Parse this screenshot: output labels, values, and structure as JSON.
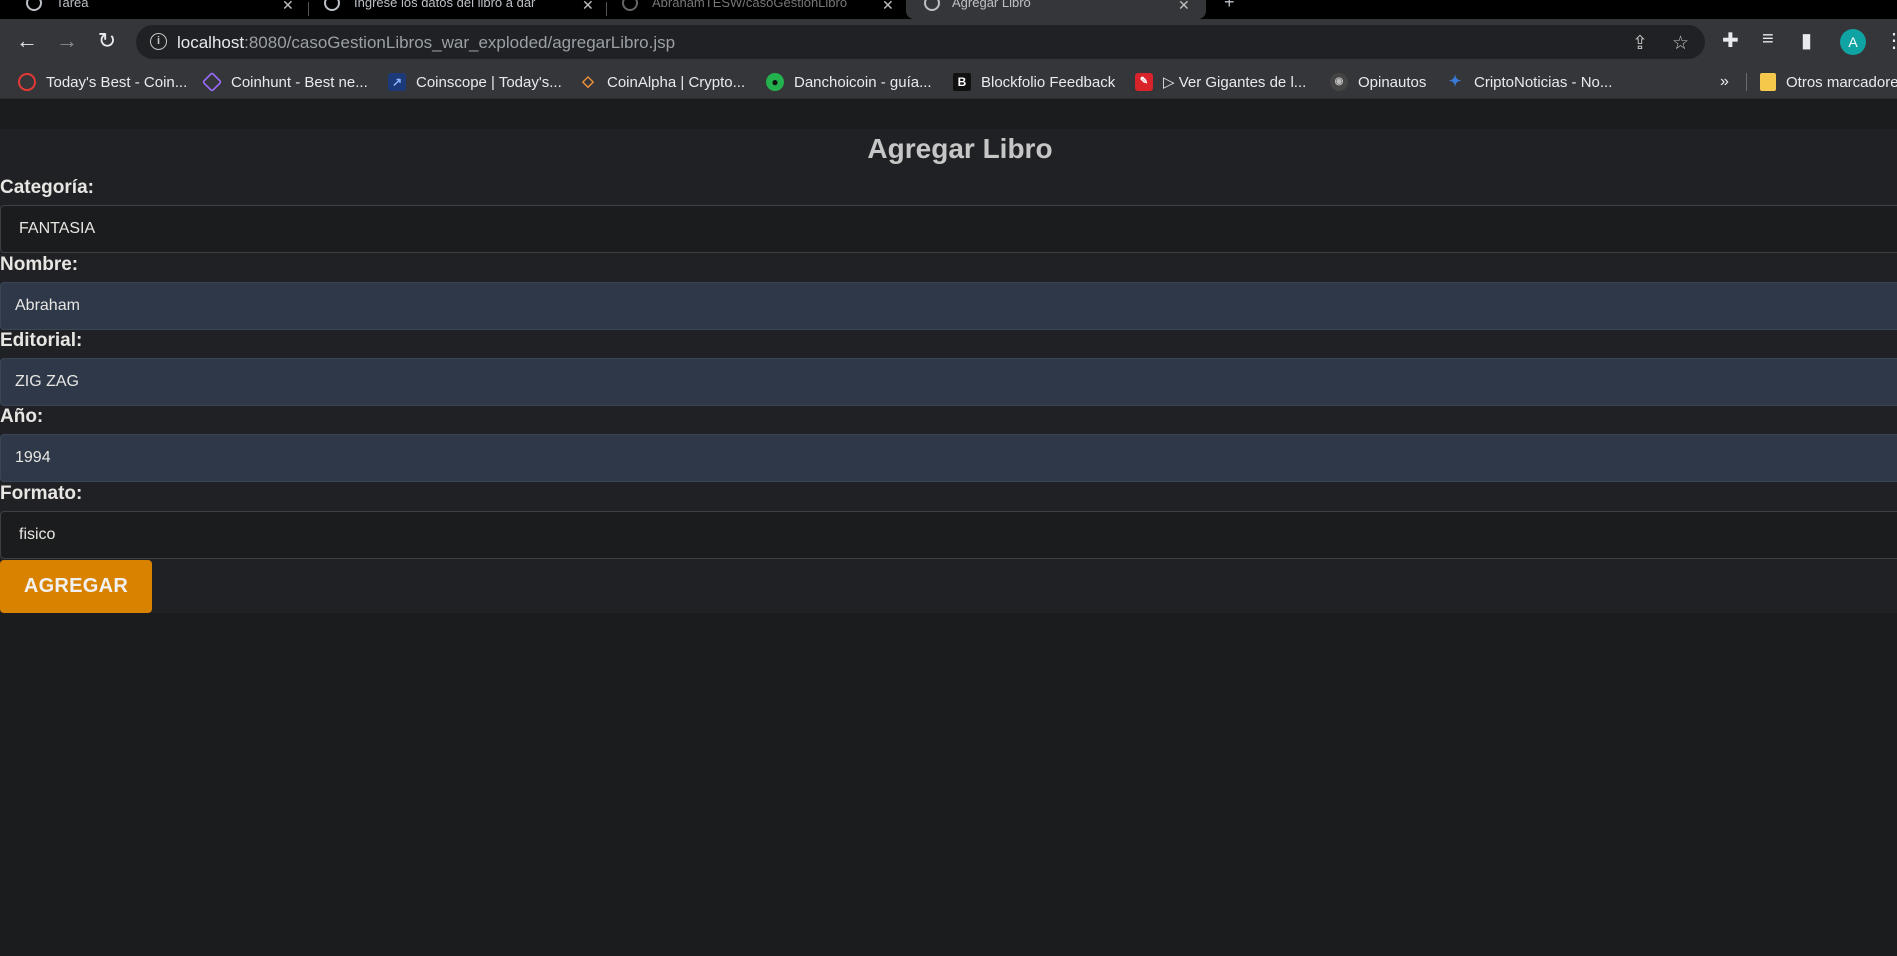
{
  "browser": {
    "tabs": [
      {
        "title": "Tarea",
        "active": false
      },
      {
        "title": "Ingrese los datos del libro a dar",
        "active": false
      },
      {
        "title": "AbrahamTESW/casoGestionLibro",
        "active": false
      },
      {
        "title": "Agregar Libro",
        "active": true
      }
    ],
    "new_tab_label": "+",
    "url_host": "localhost",
    "url_path": ":8080/casoGestionLibros_war_exploded/agregarLibro.jsp",
    "avatar_letter": "A",
    "bookmarks": [
      {
        "label": "Today's Best - Coin...",
        "icon": "target-icon",
        "color": "#e53935"
      },
      {
        "label": "Coinhunt - Best ne...",
        "icon": "diamond-icon",
        "color": "#9c6bff"
      },
      {
        "label": "Coinscope | Today's...",
        "icon": "scope-icon",
        "color": "#3f7be0"
      },
      {
        "label": "CoinAlpha | Crypto...",
        "icon": "alpha-icon",
        "color": "#f0913a"
      },
      {
        "label": "Danchoicoin - guía...",
        "icon": "coin-icon",
        "color": "#22b14c"
      },
      {
        "label": "Blockfolio Feedback",
        "icon": "b-icon",
        "color": "#111111"
      },
      {
        "label": "▷ Ver Gigantes de l...",
        "icon": "comic-icon",
        "color": "#d8232a"
      },
      {
        "label": "Opinautos",
        "icon": "car-icon",
        "color": "#555555"
      },
      {
        "label": "CriptoNoticias - No...",
        "icon": "crypto-icon",
        "color": "#3a7bd5"
      }
    ],
    "overflow_label": "»",
    "other_bookmarks_label": "Otros marcadores"
  },
  "form": {
    "title": "Agregar Libro",
    "fields": [
      {
        "label": "Categoría:",
        "value": "FANTASIA"
      },
      {
        "label": "Nombre:",
        "value": "Abraham"
      },
      {
        "label": "Editorial:",
        "value": "ZIG ZAG"
      },
      {
        "label": "Año:",
        "value": "1994"
      },
      {
        "label": "Formato:",
        "value": "fisico"
      }
    ],
    "submit_label": "AGREGAR"
  },
  "colors": {
    "accent_button": "#d98200",
    "filled_input": "#2e3848",
    "page_bg": "#1b1c1e"
  }
}
